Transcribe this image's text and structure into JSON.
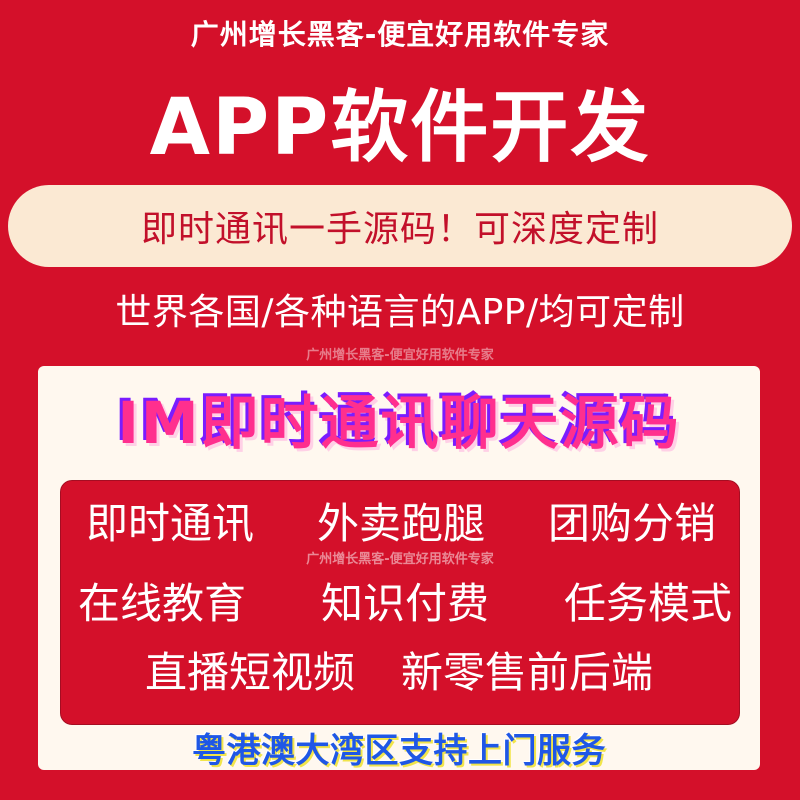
{
  "header": {
    "shop_name": "广州增长黑客-便宜好用软件专家",
    "main_title": "APP软件开发",
    "pill_text": "即时通讯一手源码！可深度定制",
    "subline": "世界各国/各种语言的APP/均可定制"
  },
  "watermark": "广州增长黑客-便宜好用软件专家",
  "card": {
    "title": "IM即时通讯聊天源码",
    "features": [
      [
        "即时通讯",
        "外卖跑腿",
        "团购分销"
      ],
      [
        "在线教育",
        "知识付费",
        "任务模式"
      ],
      [
        "直播短视频",
        "新零售前后端"
      ]
    ],
    "bottom_banner": "粤港澳大湾区支持上门服务"
  },
  "colors": {
    "background": "#d4102a",
    "pill": "#fbe9d3",
    "card": "#fff8ef",
    "title_pink": "#ff2f8e",
    "banner_blue": "#1f57e6"
  }
}
